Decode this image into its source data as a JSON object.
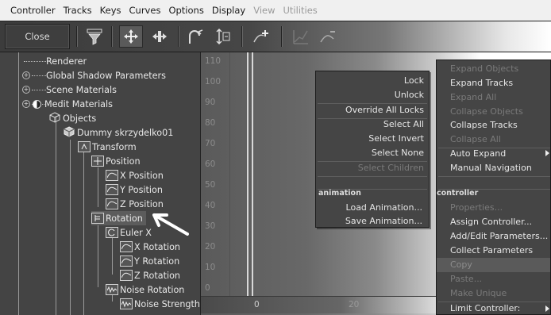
{
  "menubar": {
    "items": [
      {
        "label": "Controller",
        "enabled": true
      },
      {
        "label": "Tracks",
        "enabled": true
      },
      {
        "label": "Keys",
        "enabled": true
      },
      {
        "label": "Curves",
        "enabled": true
      },
      {
        "label": "Options",
        "enabled": true
      },
      {
        "label": "Display",
        "enabled": true
      },
      {
        "label": "View",
        "enabled": false
      },
      {
        "label": "Utilities",
        "enabled": false
      }
    ]
  },
  "toolbar": {
    "close_label": "Close",
    "icons": [
      "filters-icon",
      "move-keys-icon",
      "move-keys-horizontal-icon",
      "slide-keys-icon",
      "scale-keys-icon",
      "add-keys-icon",
      "draw-curves-icon",
      "reduce-keys-icon"
    ]
  },
  "tree": {
    "items": [
      {
        "label": "Renderer"
      },
      {
        "label": "Global Shadow Parameters"
      },
      {
        "label": "Scene Materials"
      },
      {
        "label": "Medit Materials"
      },
      {
        "label": "Objects"
      },
      {
        "label": "Dummy skrzydelko01"
      },
      {
        "label": "Transform"
      },
      {
        "label": "Position"
      },
      {
        "label": "X Position"
      },
      {
        "label": "Y Position"
      },
      {
        "label": "Z Position"
      },
      {
        "label": "Rotation"
      },
      {
        "label": "Euler X"
      },
      {
        "label": "X Rotation"
      },
      {
        "label": "Y Rotation"
      },
      {
        "label": "Z Rotation"
      },
      {
        "label": "Noise Rotation"
      },
      {
        "label": "Noise Strength"
      }
    ]
  },
  "curve_editor": {
    "y_ticks": [
      "110",
      "100",
      "90",
      "80",
      "70",
      "60",
      "50",
      "40",
      "30",
      "20",
      "10",
      "0"
    ],
    "timeline_labels": [
      "0",
      "20"
    ]
  },
  "menu_left": {
    "items": [
      {
        "label": "Lock",
        "enabled": true
      },
      {
        "label": "Unlock",
        "enabled": true
      },
      {
        "label": "Override All Locks",
        "enabled": true
      },
      {
        "label": "Select All",
        "enabled": true
      },
      {
        "label": "Select Invert",
        "enabled": true
      },
      {
        "label": "Select None",
        "enabled": true
      },
      {
        "label": "Select Children",
        "enabled": false
      },
      {
        "label": "animation",
        "enabled": true
      },
      {
        "label": "Load Animation...",
        "enabled": true
      },
      {
        "label": "Save Animation...",
        "enabled": true
      }
    ]
  },
  "menu_right": {
    "items": [
      {
        "label": "Expand Objects",
        "enabled": false
      },
      {
        "label": "Expand Tracks",
        "enabled": true
      },
      {
        "label": "Expand All",
        "enabled": false
      },
      {
        "label": "Collapse Objects",
        "enabled": false
      },
      {
        "label": "Collapse Tracks",
        "enabled": true
      },
      {
        "label": "Collapse All",
        "enabled": false
      },
      {
        "label": "Auto Expand",
        "enabled": true
      },
      {
        "label": "Manual Navigation",
        "enabled": true
      },
      {
        "label": "controller",
        "enabled": true
      },
      {
        "label": "Properties...",
        "enabled": false
      },
      {
        "label": "Assign Controller...",
        "enabled": true
      },
      {
        "label": "Add/Edit Parameters...",
        "enabled": true
      },
      {
        "label": "Collect Parameters",
        "enabled": true
      },
      {
        "label": "Copy",
        "enabled": false
      },
      {
        "label": "Paste...",
        "enabled": false
      },
      {
        "label": "Make Unique",
        "enabled": false
      },
      {
        "label": "Limit Controller:",
        "enabled": true
      }
    ]
  }
}
